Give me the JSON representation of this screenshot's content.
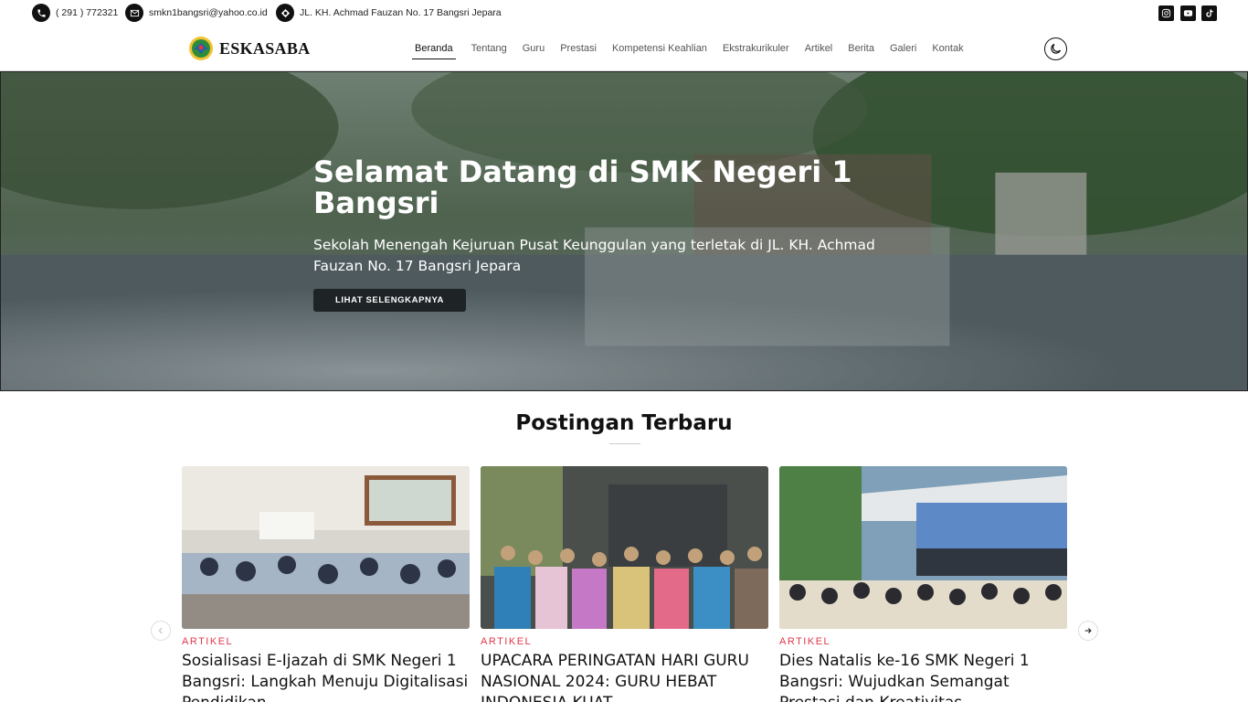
{
  "topbar": {
    "phone": "( 291 ) 772321",
    "email": "smkn1bangsri@yahoo.co.id",
    "address": "JL. KH. Achmad Fauzan No. 17 Bangsri Jepara",
    "social_icons": [
      "instagram-icon",
      "youtube-icon",
      "tiktok-icon"
    ]
  },
  "navbar": {
    "brand": "ESKASABA",
    "menu": [
      "Beranda",
      "Tentang",
      "Guru",
      "Prestasi",
      "Kompetensi Keahlian",
      "Ekstrakurikuler",
      "Artikel",
      "Berita",
      "Galeri",
      "Kontak"
    ],
    "active": "Beranda"
  },
  "hero": {
    "title": "Selamat Datang di SMK Negeri 1 Bangsri",
    "subtitle": "Sekolah Menengah Kejuruan Pusat Keunggulan yang terletak di JL. KH. Achmad Fauzan No. 17 Bangsri Jepara",
    "button": "LIHAT SELENGKAPNYA"
  },
  "posts": {
    "heading": "Postingan Terbaru",
    "items": [
      {
        "category": "ARTIKEL",
        "title": "Sosialisasi E-Ijazah di SMK Negeri 1 Bangsri: Langkah Menuju Digitalisasi Pendidikan"
      },
      {
        "category": "ARTIKEL",
        "title": "UPACARA PERINGATAN HARI GURU NASIONAL 2024: GURU HEBAT INDONESIA KUAT"
      },
      {
        "category": "ARTIKEL",
        "title": "Dies Natalis ke-16 SMK Negeri 1 Bangsri: Wujudkan Semangat Prestasi dan Kreativitas"
      }
    ]
  },
  "colors": {
    "accent": "#e0364b",
    "dark": "#111111"
  }
}
